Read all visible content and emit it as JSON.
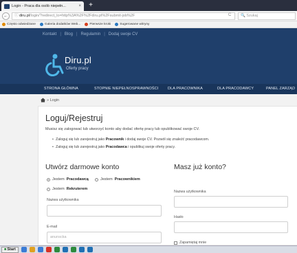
{
  "browser": {
    "tab_title": "Login - Praca dla osób niepełn...",
    "tab_close": "×",
    "new_tab": "+",
    "url_domain": "diru.pl",
    "url_rest": "/login/?redirect_to=http%3A%2F%2Fdiru.pl%2Fsubmit-job%2F",
    "search_placeholder": "Szukaj",
    "bookmarks": [
      {
        "label": "Często odwiedzane",
        "color": "#e08a00"
      },
      {
        "label": "Galeria dodatków Web...",
        "color": "#2b79c2"
      },
      {
        "label": "Pierwsze kroki",
        "color": "#d9401f"
      },
      {
        "label": "Sugerowane witryny",
        "color": "#2b79c2"
      }
    ]
  },
  "site": {
    "top_links": [
      "Kontakt",
      "Blog",
      "Regulamin",
      "Dodaj swoje CV"
    ],
    "logo_name": "Diru.pl",
    "logo_sub": "Oferty pracy",
    "nav": [
      "STRONA GŁÓWNA",
      "STOPNIE NIEPEŁNOSPRAWNOŚCI",
      "DLA PRACOWNIKA",
      "DLA PRACODAWCY",
      "PANEL ZARZĄD"
    ]
  },
  "breadcrumb": "» Login",
  "main": {
    "title": "Loguj/Rejestruj",
    "intro": "Musisz się zalogować lub utworzyć konto aby dodać ofertę pracy lub opublikować swoje CV.",
    "bullet1_pre": "Zaloguj się lub zarejestruj jako ",
    "bullet1_bold": "Pracownik",
    "bullet1_post": " i dodaj swoje CV. Pozwól się znaleźć pracodawcom.",
    "bullet2_pre": "Zaloguj się lub zarejestruj jako ",
    "bullet2_bold": "Pracodawca",
    "bullet2_post": " i opublikuj swoje oferty pracy."
  },
  "register": {
    "title": "Utwórz darmowe konto",
    "radio1_pre": "Jestem ",
    "radio1_bold": "Pracodawcą",
    "radio2_pre": "Jestem ",
    "radio2_bold": "Pracownikiem",
    "radio3_pre": "Jestem ",
    "radio3_bold": "Rekruterem",
    "username_label": "Nazwa użytkownika",
    "email_label": "E-mail",
    "email_placeholder": "anunscka"
  },
  "login": {
    "title": "Masz już konto?",
    "username_label": "Nazwa użytkownika",
    "password_label": "Hasło",
    "remember_label": "Zapamiętaj mnie"
  },
  "taskbar": {
    "start": "Start",
    "icons": [
      "#3a7bd5",
      "#e0a020",
      "#3a7bd5",
      "#d93025",
      "#2c8a3c",
      "#1f6fb3",
      "#2c8a3c",
      "#1f6fb3",
      "#1f6fb3"
    ]
  },
  "colors": {
    "header_bg": "#1f3f6b",
    "nav_bg": "#19355b"
  }
}
